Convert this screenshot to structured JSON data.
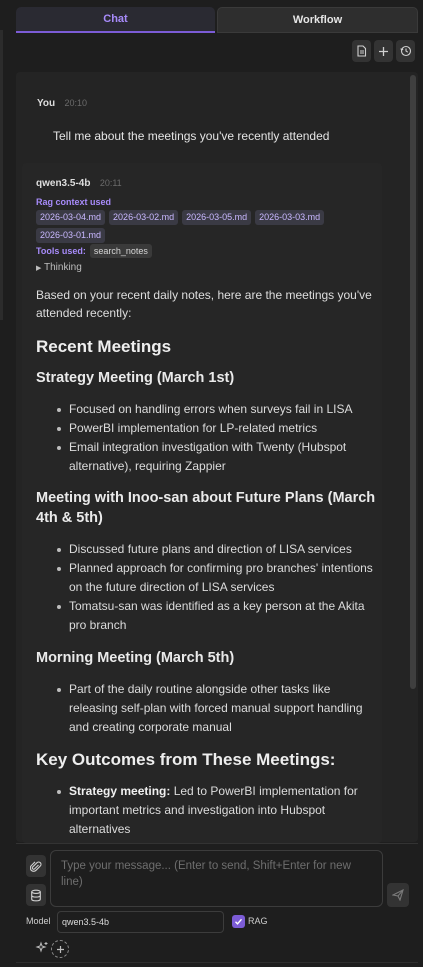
{
  "tabs": [
    {
      "label": "Chat",
      "active": true
    },
    {
      "label": "Workflow",
      "active": false
    }
  ],
  "toolbar": {
    "icons": [
      "document-icon",
      "plus-icon",
      "history-icon"
    ]
  },
  "user_message": {
    "author": "You",
    "time": "20:10",
    "text": "Tell me about the meetings you've recently attended"
  },
  "assistant_message": {
    "author": "qwen3.5-4b",
    "time": "20:11",
    "rag_label": "Rag context used",
    "rag_chips": [
      "2026-03-04.md",
      "2026-03-02.md",
      "2026-03-05.md",
      "2026-03-03.md",
      "2026-03-01.md"
    ],
    "tools_label": "Tools used:",
    "tools": [
      "search_notes"
    ],
    "thinking_label": "Thinking",
    "intro": "Based on your recent daily notes, here are the meetings you've attended recently:",
    "h_recent": "Recent Meetings",
    "s1_title": "Strategy Meeting (March 1st)",
    "s1_items": [
      "Focused on handling errors when surveys fail in LISA",
      "PowerBI implementation for LP-related metrics",
      "Email integration investigation with Twenty (Hubspot alternative), requiring Zappier"
    ],
    "s2_title": "Meeting with Inoo-san about Future Plans (March 4th & 5th)",
    "s2_items": [
      "Discussed future plans and direction of LISA services",
      "Planned approach for confirming pro branches' intentions on the future direction of LISA services",
      "Tomatsu-san was identified as a key person at the Akita pro branch"
    ],
    "s3_title": "Morning Meeting (March 5th)",
    "s3_items": [
      "Part of the daily routine alongside other tasks like releasing self-plan with forced manual support handling and creating corporate manual"
    ],
    "h_outcomes": "Key Outcomes from These Meetings:",
    "outcome_bold": "Strategy meeting:",
    "outcome_text": " Led to PowerBI implementation for important metrics and investigation into Hubspot alternatives"
  },
  "composer": {
    "placeholder": "Type your message... (Enter to send, Shift+Enter for new line)",
    "model_label": "Model",
    "model_value": "qwen3.5-4b",
    "rag_label": "RAG",
    "rag_checked": true
  },
  "colors": {
    "accent": "#a78bfa",
    "background": "#1e1e1e",
    "panel": "#242424"
  }
}
